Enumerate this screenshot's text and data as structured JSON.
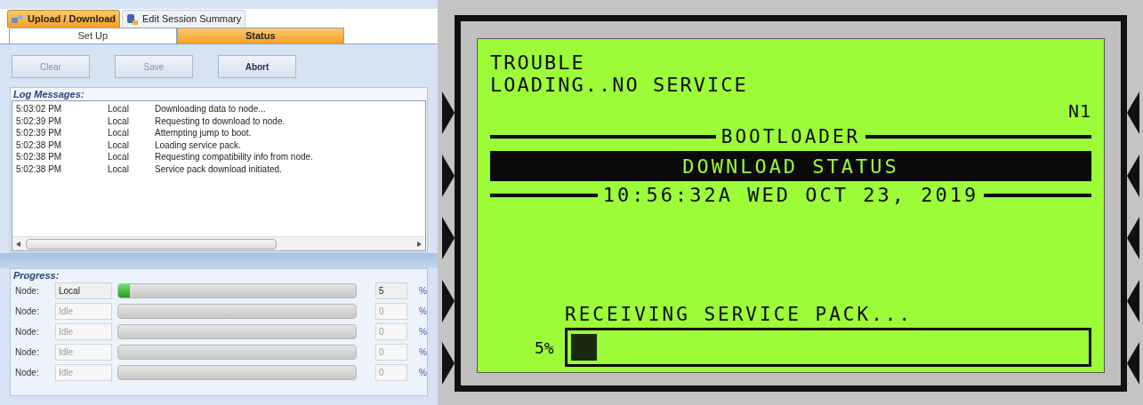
{
  "tabs": [
    {
      "label": "Upload / Download",
      "selected": true
    },
    {
      "label": "Edit Session Summary",
      "selected": false
    }
  ],
  "subtabs": [
    {
      "label": "Set Up",
      "selected": false
    },
    {
      "label": "Status",
      "selected": true
    }
  ],
  "buttons": [
    {
      "label": "Clear",
      "disabled": true
    },
    {
      "label": "Save",
      "disabled": true
    },
    {
      "label": "Abort",
      "disabled": false
    }
  ],
  "log": {
    "title": "Log Messages:",
    "rows": [
      {
        "time": "5:03:02 PM",
        "source": "Local",
        "message": "Downloading data to node..."
      },
      {
        "time": "5:02:39 PM",
        "source": "Local",
        "message": "Requesting to download to node."
      },
      {
        "time": "5:02:39 PM",
        "source": "Local",
        "message": "Attempting jump to boot."
      },
      {
        "time": "5:02:38 PM",
        "source": "Local",
        "message": "Loading service pack."
      },
      {
        "time": "5:02:38 PM",
        "source": "Local",
        "message": "Requesting compatibility info from node."
      },
      {
        "time": "5:02:38 PM",
        "source": "Local",
        "message": "Service pack download initiated."
      }
    ]
  },
  "progress": {
    "title": "Progress:",
    "nodes": [
      {
        "label": "Node:",
        "name": "Local",
        "active": true,
        "level": 0.05,
        "percent": "5",
        "unit": "%"
      },
      {
        "label": "Node:",
        "name": "Idle",
        "active": false,
        "level": 0,
        "percent": "0",
        "unit": "%"
      },
      {
        "label": "Node:",
        "name": "Idle",
        "active": false,
        "level": 0,
        "percent": "0",
        "unit": "%"
      },
      {
        "label": "Node:",
        "name": "Idle",
        "active": false,
        "level": 0,
        "percent": "0",
        "unit": "%"
      },
      {
        "label": "Node:",
        "name": "Idle",
        "active": false,
        "level": 0,
        "percent": "0",
        "unit": "%"
      }
    ]
  },
  "lcd": {
    "lines": [
      "TROUBLE",
      "LOADING..NO SERVICE"
    ],
    "node": "N1",
    "section": "BOOTLOADER",
    "banner": "DOWNLOAD STATUS",
    "datetime": "10:56:32A WED OCT 23, 2019",
    "status": "RECEIVING SERVICE PACK...",
    "percent": "5%",
    "level": 0.05
  }
}
